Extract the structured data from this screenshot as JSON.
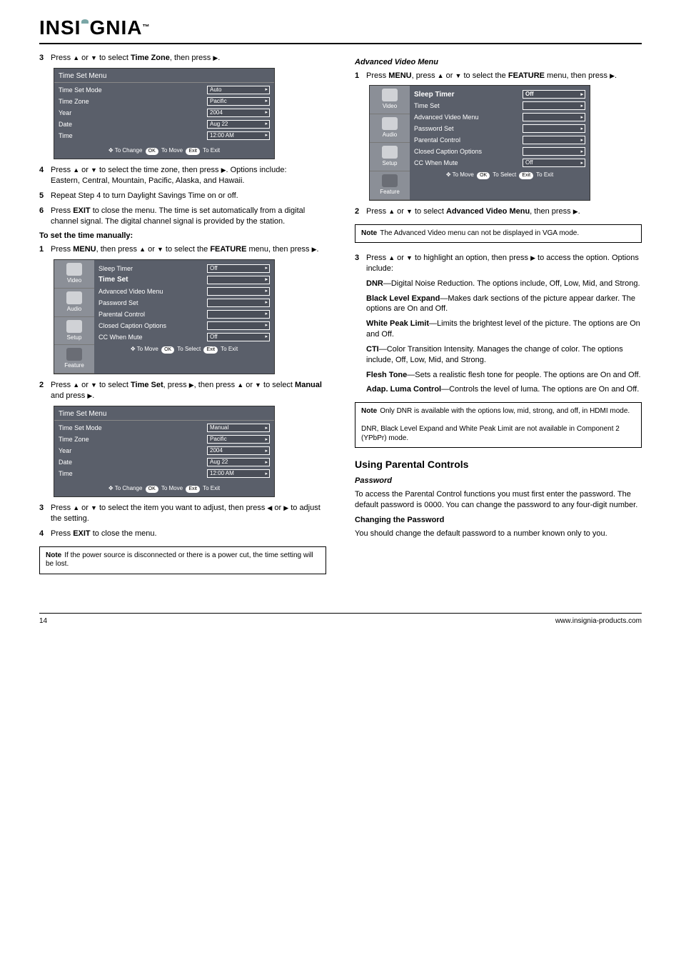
{
  "logo": "INSIGNIA",
  "left": {
    "step3": {
      "num": "3",
      "text_a": "Press ",
      "text_b": " or ",
      "text_c": " to select ",
      "time_zone_bold": "Time Zone",
      "text_d": ", then press "
    },
    "auto_menu": {
      "title": "Time Set Menu",
      "rows": [
        {
          "label": "Time Set Mode",
          "value": "Auto"
        },
        {
          "label": "Time Zone",
          "value": "Pacific"
        },
        {
          "label": "Year",
          "value": "2004"
        },
        {
          "label": "Date",
          "value": "Aug 22"
        },
        {
          "label": "Time",
          "value": "12:00  AM"
        }
      ],
      "footer": {
        "a": "To Change",
        "ok": "OK",
        "b": "To Move",
        "exit": "Exit",
        "c": "To Exit"
      }
    },
    "step4": {
      "num": "4",
      "text_a": "Press ",
      "text_b": " or ",
      "text_c": " to select the time zone, then press ",
      "text_d": ". Options include:",
      "zones": "Eastern, Central, Mountain, Pacific, Alaska, and Hawaii."
    },
    "step5a": {
      "num": "5",
      "text_a": "Repeat Step 4 to turn Daylight Savings Time on or off."
    },
    "step6a": {
      "num": "6",
      "text_a": "Press ",
      "exit_bold": "EXIT",
      "text_b": " to close the menu. The time is set automatically from a digital channel signal. The digital channel signal is provided by the station."
    },
    "manual_head": "To set the time manually:",
    "step1": {
      "num": "1",
      "text_a": "Press ",
      "menu_bold": "MENU",
      "text_b": ", then press ",
      "text_c": " or ",
      "text_d": " to select the ",
      "feature_bold": "FEATURE",
      "text_e": " menu, then press "
    },
    "feature_menu": {
      "side": [
        {
          "label": "Video"
        },
        {
          "label": "Audio"
        },
        {
          "label": "Setup"
        },
        {
          "label": "Feature"
        }
      ],
      "rows": [
        {
          "label": "Sleep Timer",
          "value": "Off"
        },
        {
          "label": "Time Set",
          "value": "",
          "hl": true
        },
        {
          "label": "Advanced  Video  Menu",
          "value": ""
        },
        {
          "label": "Password   Set",
          "value": ""
        },
        {
          "label": "Parental  Control",
          "value": ""
        },
        {
          "label": "Closed  Caption  Options",
          "value": ""
        },
        {
          "label": "CC  When  Mute",
          "value": "Off"
        }
      ],
      "footer": {
        "a": "To Move",
        "ok": "OK",
        "b": "To Select",
        "exit": "Exit",
        "c": "To Exit"
      }
    },
    "step2": {
      "num": "2",
      "text_a": "Press ",
      "text_b": " or ",
      "text_c": " to select ",
      "time_set_bold": "Time Set",
      "text_d": ", press ",
      "text_e": ", then press ",
      "text_f": " or ",
      "text_g": " to select ",
      "manual_bold": "Manual",
      "text_h": " and press "
    },
    "manual_menu": {
      "title": "Time Set Menu",
      "rows": [
        {
          "label": "Time Set Mode",
          "value": "Manual"
        },
        {
          "label": "Time Zone",
          "value": "Pacific"
        },
        {
          "label": "Year",
          "value": "2004"
        },
        {
          "label": "Date",
          "value": "Aug 22"
        },
        {
          "label": "Time",
          "value": "12:00  AM"
        }
      ],
      "footer": {
        "a": "To Change",
        "ok": "OK",
        "b": "To Move",
        "exit": "Exit",
        "c": "To Exit"
      }
    },
    "step3b": {
      "num": "3",
      "text_a": "Press ",
      "text_b": " or ",
      "text_c": " to select the item you want to adjust, then press ",
      "text_d": " or ",
      "text_e": " to adjust the setting."
    },
    "step4b": {
      "num": "4",
      "text_a": "Press ",
      "exit_bold": "EXIT",
      "text_b": " to close the menu."
    },
    "note1": {
      "title": "Note",
      "text": "If the power source is disconnected or there is a power cut, the time setting will be lost."
    }
  },
  "right": {
    "avm_head": "Advanced Video Menu",
    "step1": {
      "num": "1",
      "text_a": "Press ",
      "menu_bold": "MENU",
      "text_b": ", press ",
      "text_c": " or ",
      "text_d": " to select the ",
      "feature_bold": "FEATURE",
      "text_e": " menu, then press "
    },
    "feature_menu": {
      "side": [
        {
          "label": "Video"
        },
        {
          "label": "Audio"
        },
        {
          "label": "Setup"
        },
        {
          "label": "Feature"
        }
      ],
      "rows": [
        {
          "label": "Sleep Timer",
          "value": "Off",
          "hl": true
        },
        {
          "label": "Time Set",
          "value": ""
        },
        {
          "label": "Advanced  Video  Menu",
          "value": ""
        },
        {
          "label": "Password   Set",
          "value": ""
        },
        {
          "label": "Parental  Control",
          "value": ""
        },
        {
          "label": "Closed  Caption  Options",
          "value": ""
        },
        {
          "label": "CC  When  Mute",
          "value": "Off"
        }
      ],
      "footer": {
        "a": "To Move",
        "ok": "OK",
        "b": "To Select",
        "exit": "Exit",
        "c": "To Exit"
      }
    },
    "step2": {
      "num": "2",
      "text_a": "Press ",
      "text_b": " or ",
      "text_c": " to select ",
      "avm_bold": "Advanced Video Menu",
      "text_d": ", then press "
    },
    "note2": {
      "title": "Note",
      "text": "The Advanced Video menu can not be displayed in VGA mode."
    },
    "step3": {
      "num": "3",
      "text_a": "Press ",
      "text_b": " or ",
      "text_c": " to highlight an option, then press ",
      "text_d": " to access the option. Options include:"
    },
    "opt_dnr": "DNR",
    "opt_dnr_text": "—Digital Noise Reduction. The options include, Off, Low, Mid, and Strong.",
    "opt_black": "Black Level Expand",
    "opt_black_text": "—Makes dark sections of the picture appear darker. The options are On and Off.",
    "opt_white": "White Peak Limit",
    "opt_white_text": "—Limits the brightest level of the picture. The options are On and Off.",
    "opt_cti": "CTI",
    "opt_cti_text": "—Color Transition Intensity. Manages the change of color. The options include, Off, Low, Mid, and Strong.",
    "opt_flesh": "Flesh Tone",
    "opt_flesh_text": "—Sets a realistic flesh tone for people. The options are On and Off.",
    "opt_adap": "Adap. Luma Control",
    "opt_adap_text": "—Controls the level of luma. The options are On and Off.",
    "note3": {
      "title": "Note",
      "text_a": "Only DNR is available with the options low, mid, strong, and off, in HDMI mode.",
      "text_b": "DNR, Black Level Expand and White Peak Limit are not available in Component 2 (YPbPr) mode."
    },
    "section_head": "Using Parental Controls",
    "pw_sub": "Password",
    "pw_para": "To access the Parental Control functions you must first enter the password. The default password is 0000. You can change the password to any four-digit number.",
    "change_head": "Changing the Password",
    "change_para": "You should change the default password to a number known only to you."
  },
  "footer": {
    "left": "14",
    "right": "www.insignia-products.com"
  }
}
